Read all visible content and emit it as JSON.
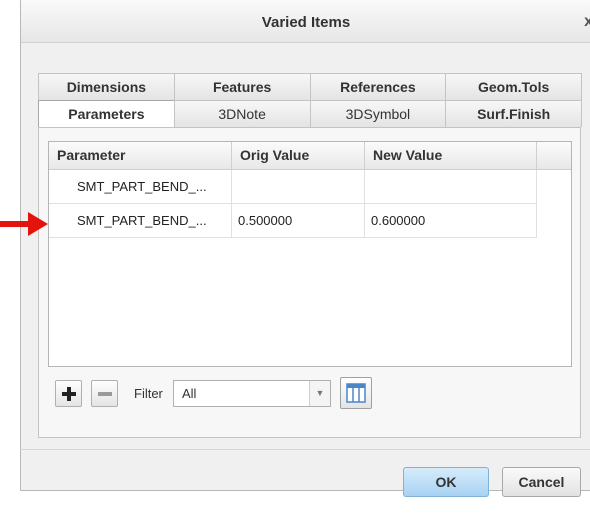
{
  "window": {
    "title": "Varied Items",
    "close_glyph": "x"
  },
  "tabs": {
    "row1": [
      {
        "label": "Dimensions"
      },
      {
        "label": "Features"
      },
      {
        "label": "References"
      },
      {
        "label": "Geom.Tols"
      }
    ],
    "row2": [
      {
        "label": "Parameters",
        "active": true
      },
      {
        "label": "3DNote"
      },
      {
        "label": "3DSymbol"
      },
      {
        "label": "Surf.Finish"
      }
    ]
  },
  "table": {
    "columns": [
      "Parameter",
      "Orig Value",
      "New Value"
    ],
    "rows": [
      {
        "parameter": "SMT_PART_BEND_...",
        "orig_value": "",
        "new_value": ""
      },
      {
        "parameter": "SMT_PART_BEND_...",
        "orig_value": "0.500000",
        "new_value": "0.600000"
      }
    ]
  },
  "toolbar": {
    "add_icon": "plus-icon",
    "remove_icon": "minus-icon",
    "filter_label": "Filter",
    "filter_value": "All",
    "columns_icon": "table-columns-icon"
  },
  "buttons": {
    "ok": "OK",
    "cancel": "Cancel"
  },
  "colors": {
    "arrow": "#e3140c",
    "ok_button": "#b8dcf6",
    "dialog_bg": "#f0f0f0"
  }
}
